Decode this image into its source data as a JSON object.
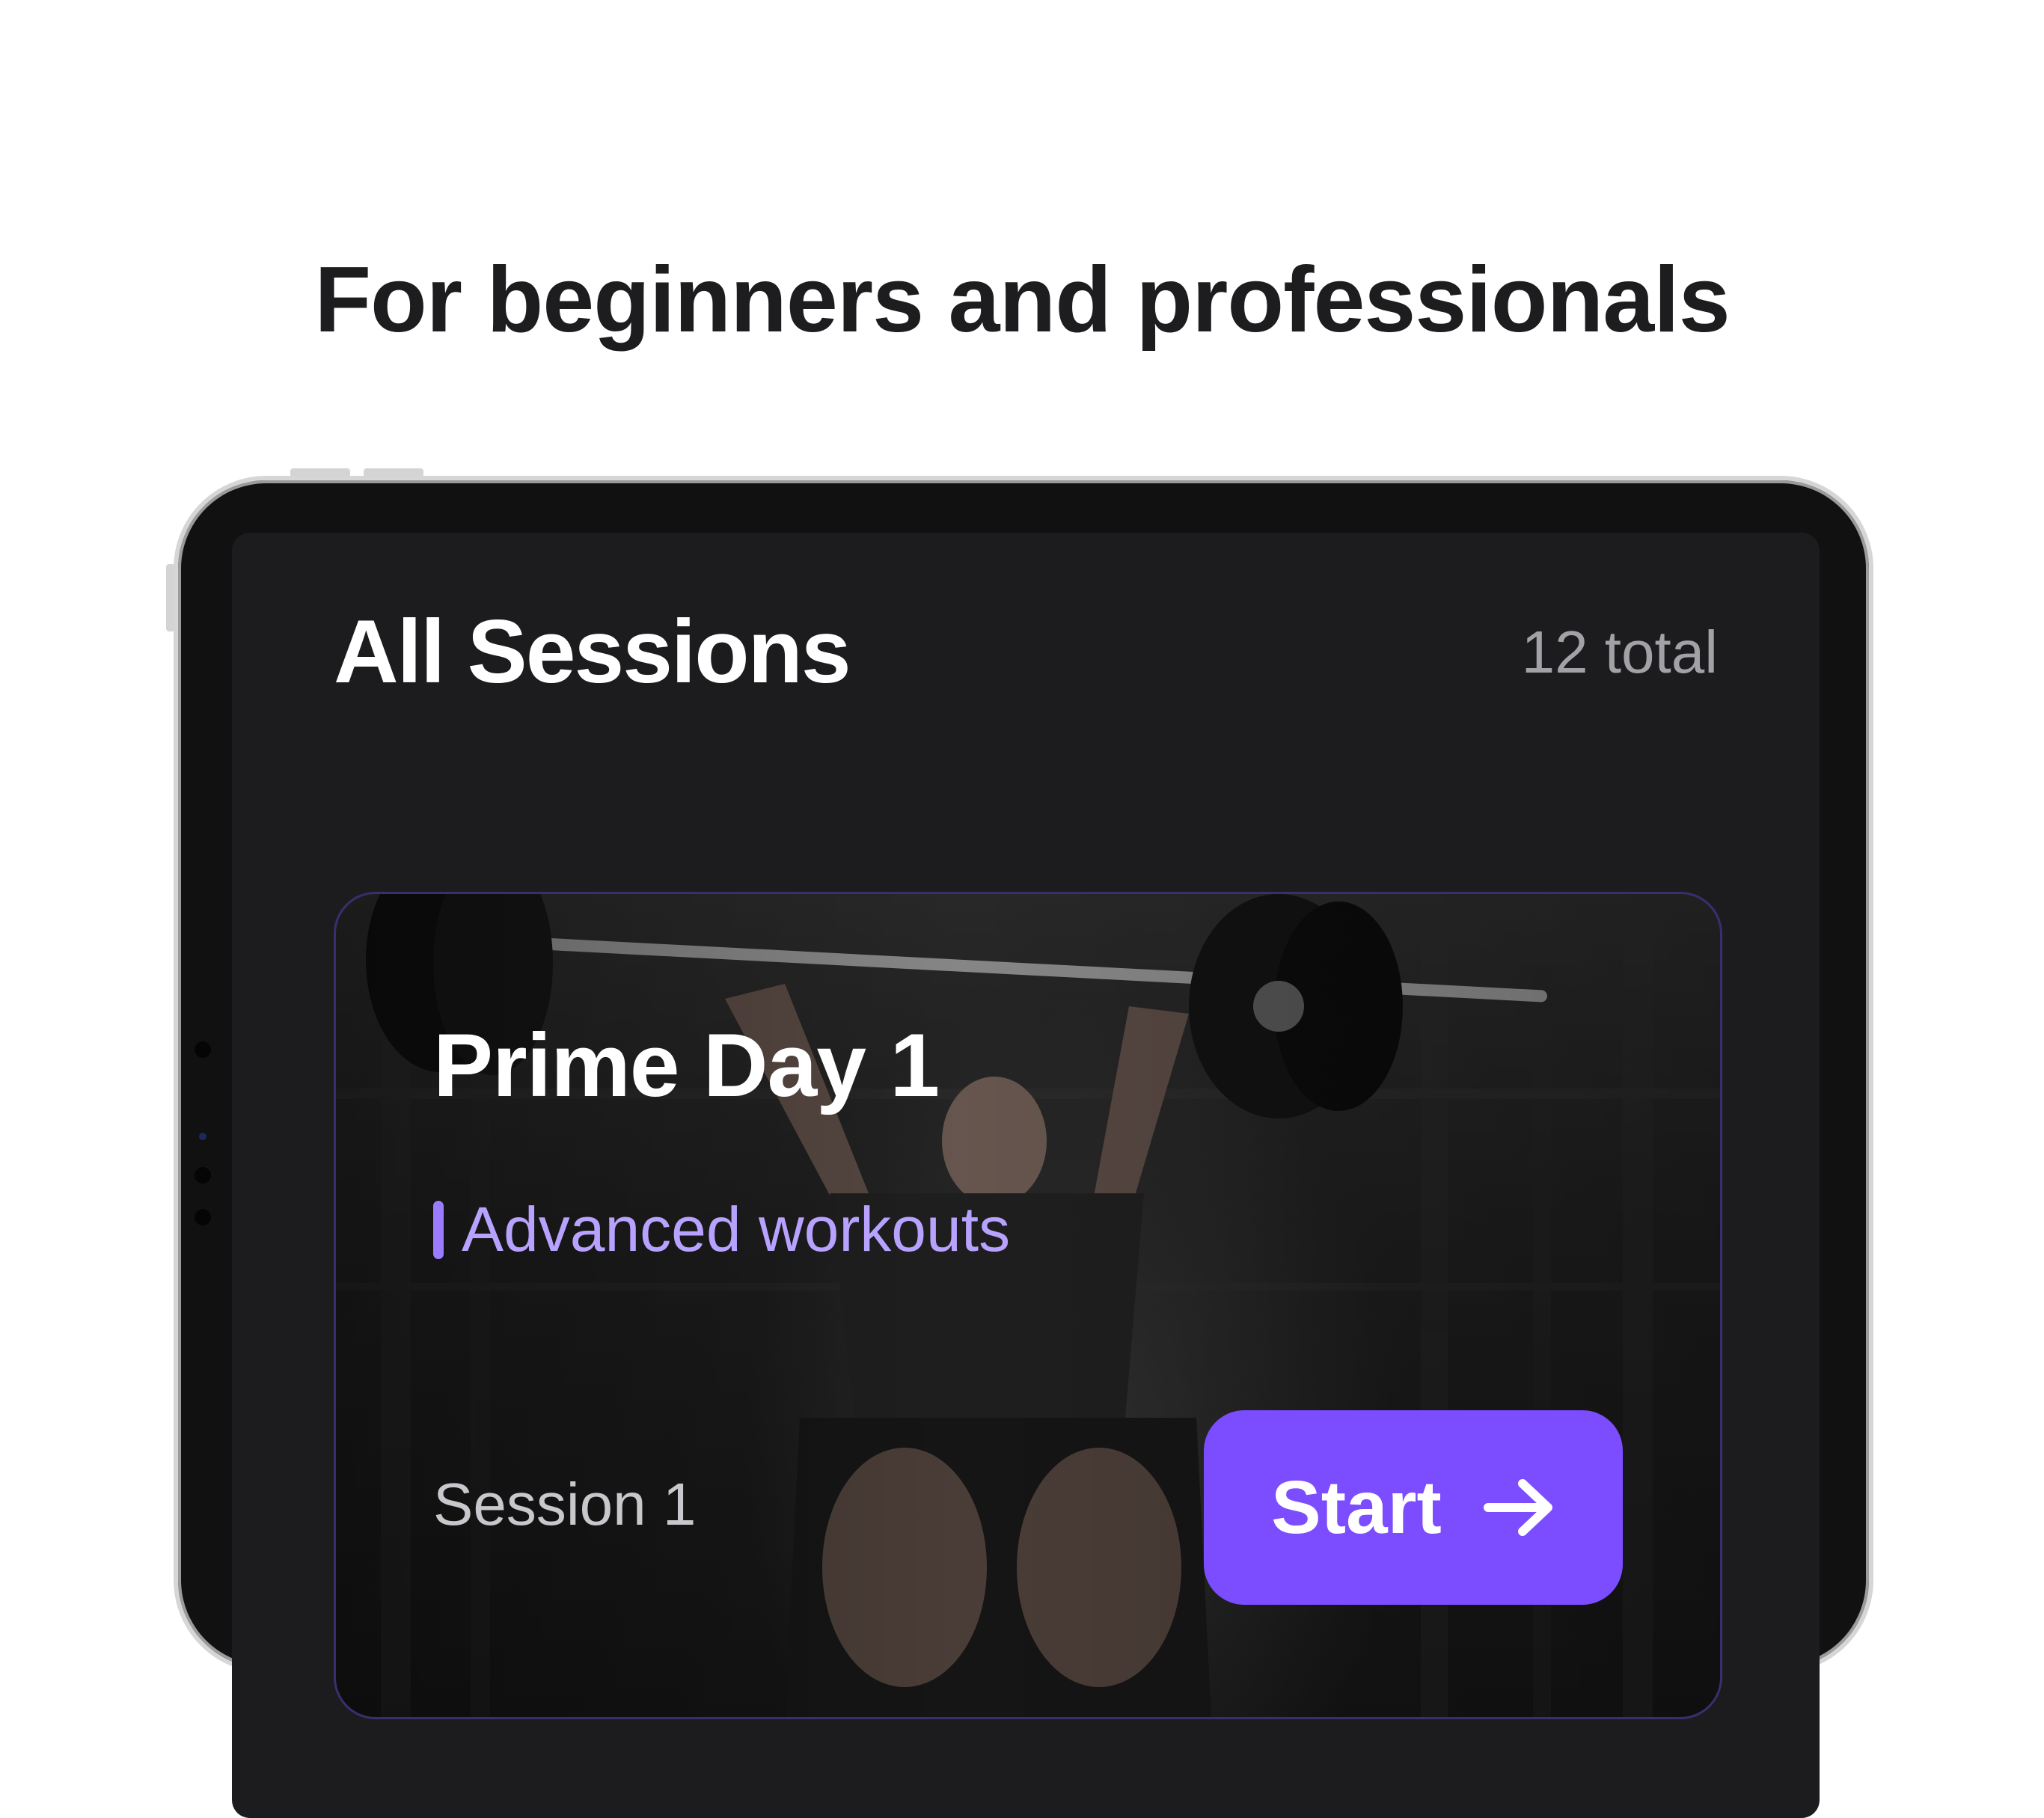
{
  "marketing": {
    "headline": "For beginners and professionals"
  },
  "screen": {
    "title": "All Sessions",
    "total": "12 total"
  },
  "card": {
    "name": "Prime Day 1",
    "level": "Advanced workouts",
    "session": "Session 1",
    "cta": "Start",
    "image": "athlete-overhead-squat-photo",
    "cta_icon": "arrow-right-icon"
  },
  "colors": {
    "accent": "#7c4dff",
    "accent_text": "#b8a2ff",
    "screen_bg": "#1c1c1e",
    "headline": "#1d1d1f"
  }
}
